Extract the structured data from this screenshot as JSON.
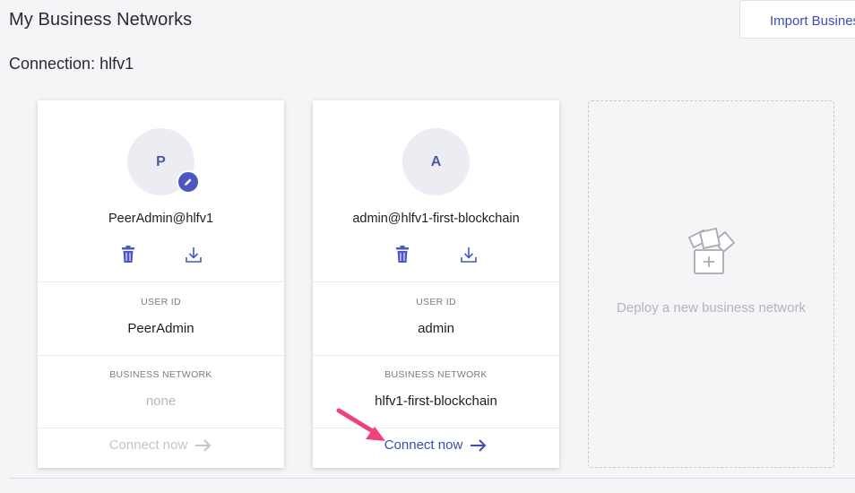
{
  "header": {
    "title": "My Business Networks",
    "import_label": "Import Business Network"
  },
  "connection": {
    "title": "Connection: hlfv1"
  },
  "cards": [
    {
      "initial": "P",
      "name": "PeerAdmin@hlfv1",
      "user_id_label": "USER ID",
      "user_id": "PeerAdmin",
      "network_label": "BUSINESS NETWORK",
      "network": "none",
      "connect_label": "Connect now",
      "connect_enabled": false
    },
    {
      "initial": "A",
      "name": "admin@hlfv1-first-blockchain",
      "user_id_label": "USER ID",
      "user_id": "admin",
      "network_label": "BUSINESS NETWORK",
      "network": "hlfv1-first-blockchain",
      "connect_label": "Connect now",
      "connect_enabled": true
    }
  ],
  "deploy": {
    "label": "Deploy a new business network"
  },
  "icons": {
    "delete": "trash-icon",
    "export": "download-icon",
    "badge": "pencil-icon",
    "deploy": "files-add-icon",
    "connect": "arrow-right-icon"
  },
  "colors": {
    "accent": "#3d4db3",
    "avatar_bg": "#ececf3",
    "disabled": "#c4c4cc",
    "annotation": "#f0417a"
  }
}
